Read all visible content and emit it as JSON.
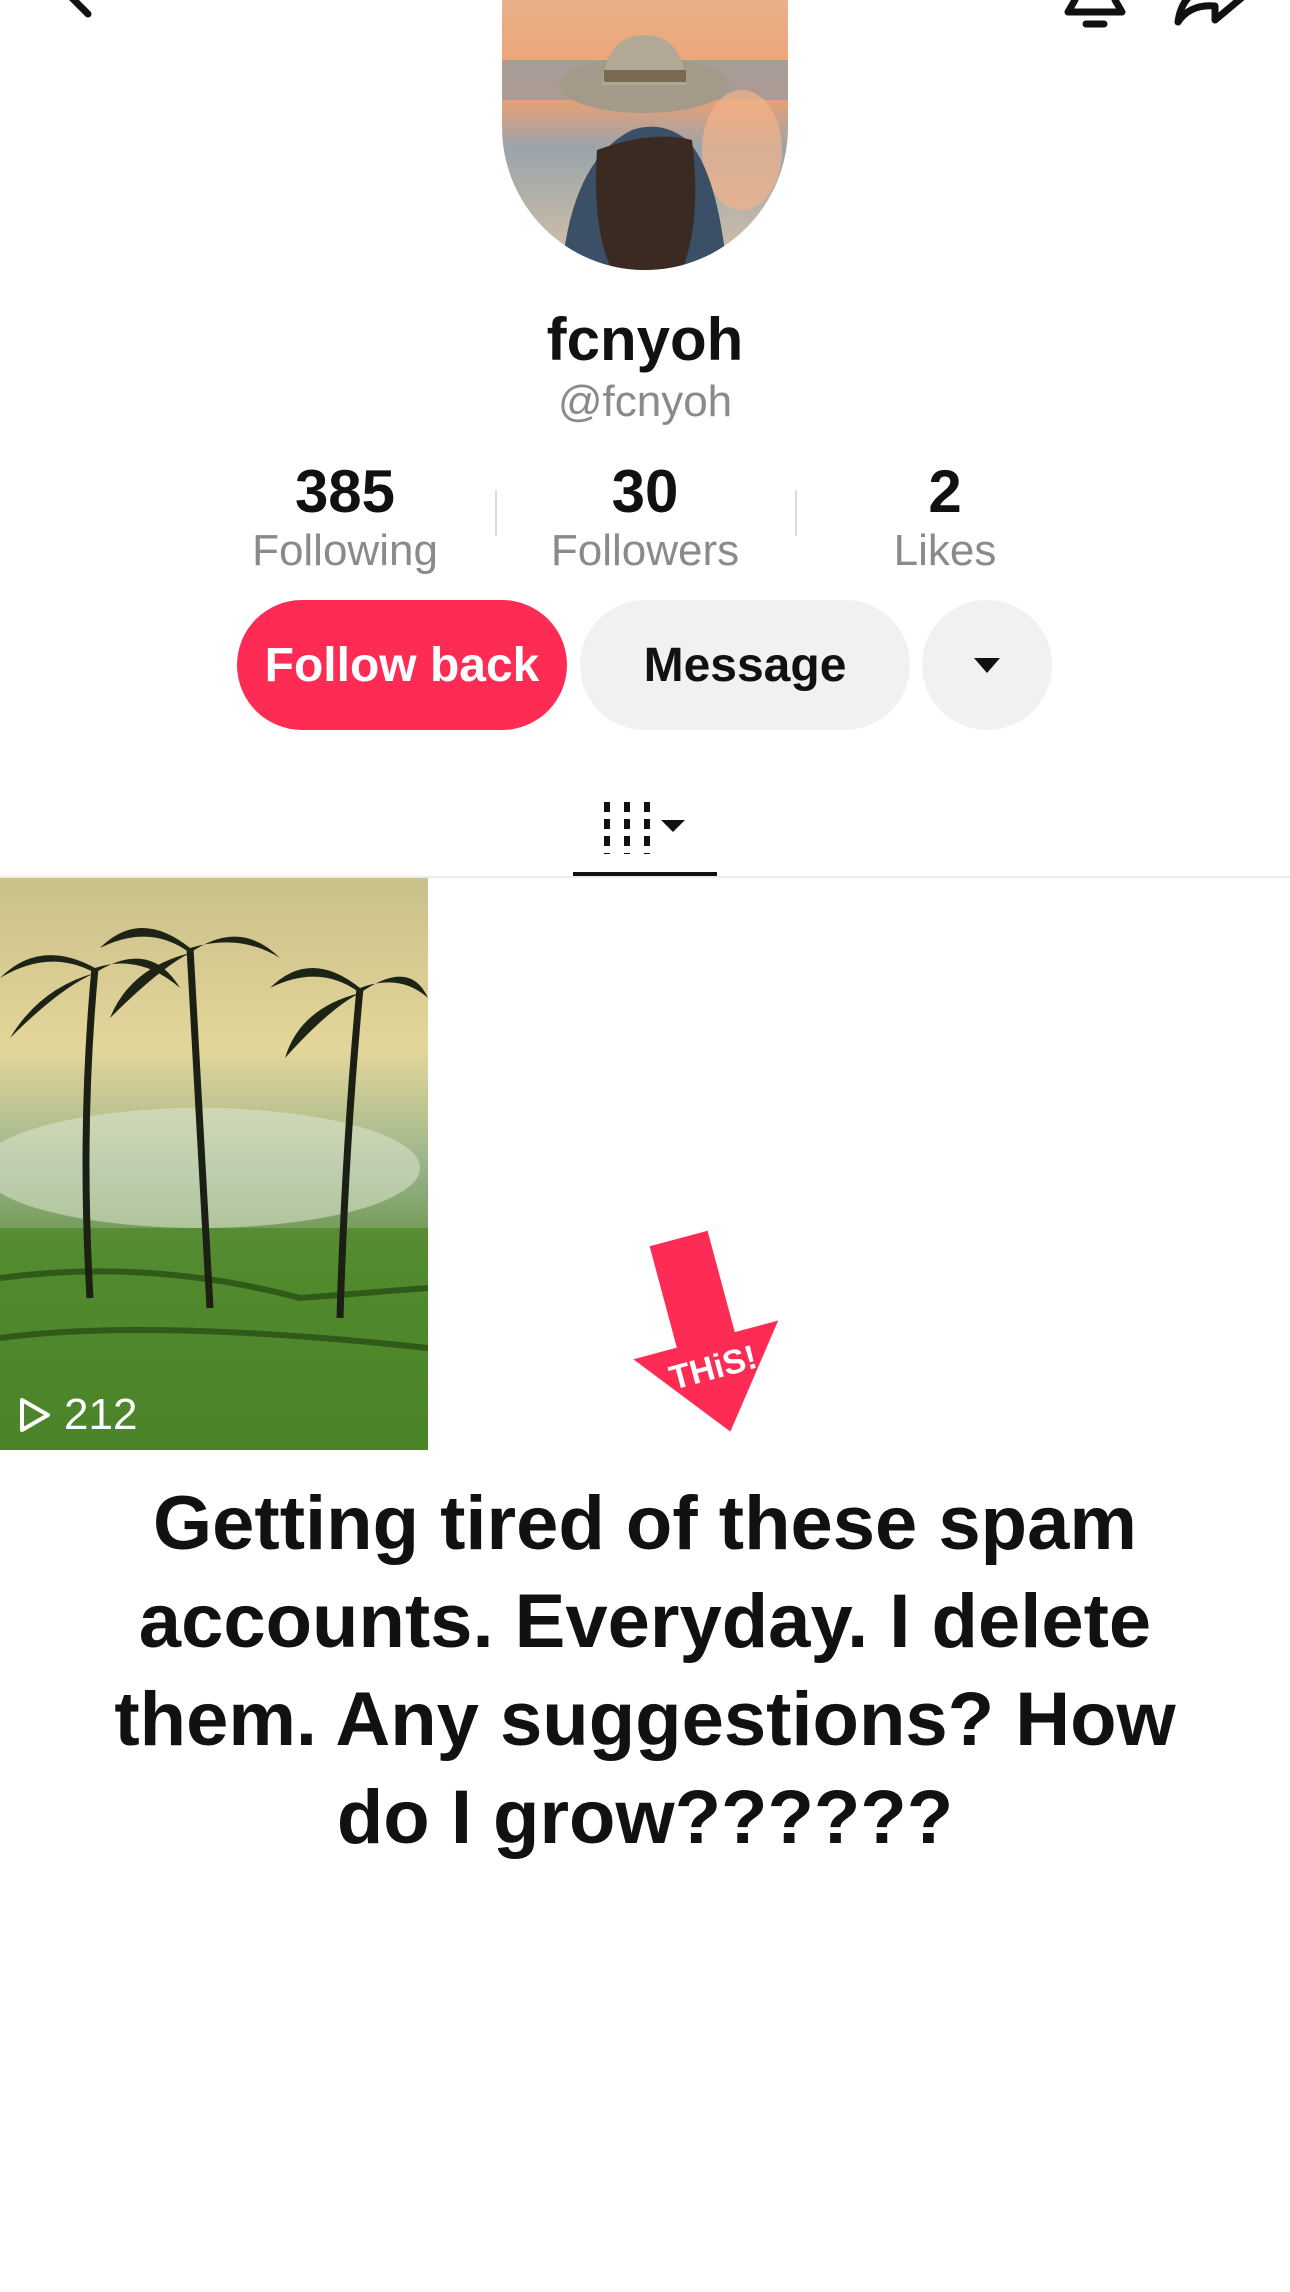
{
  "profile": {
    "display_name": "fcnyoh",
    "handle": "@fcnyoh"
  },
  "stats": [
    {
      "value": "385",
      "label": "Following"
    },
    {
      "value": "30",
      "label": "Followers"
    },
    {
      "value": "2",
      "label": "Likes"
    }
  ],
  "actions": {
    "follow_back_label": "Follow back",
    "message_label": "Message"
  },
  "videos": [
    {
      "views": "212"
    }
  ],
  "overlay": {
    "arrow_text": "THiS!",
    "caption": "Getting tired of these spam accounts. Everyday. I delete them. Any suggestions? How do I grow??????"
  },
  "colors": {
    "accent": "#fe2c55",
    "secondary_button": "#f1f1f2"
  },
  "icons": [
    "back-icon",
    "bell-icon",
    "share-icon",
    "chevron-down-icon",
    "grid-icon",
    "play-icon"
  ]
}
